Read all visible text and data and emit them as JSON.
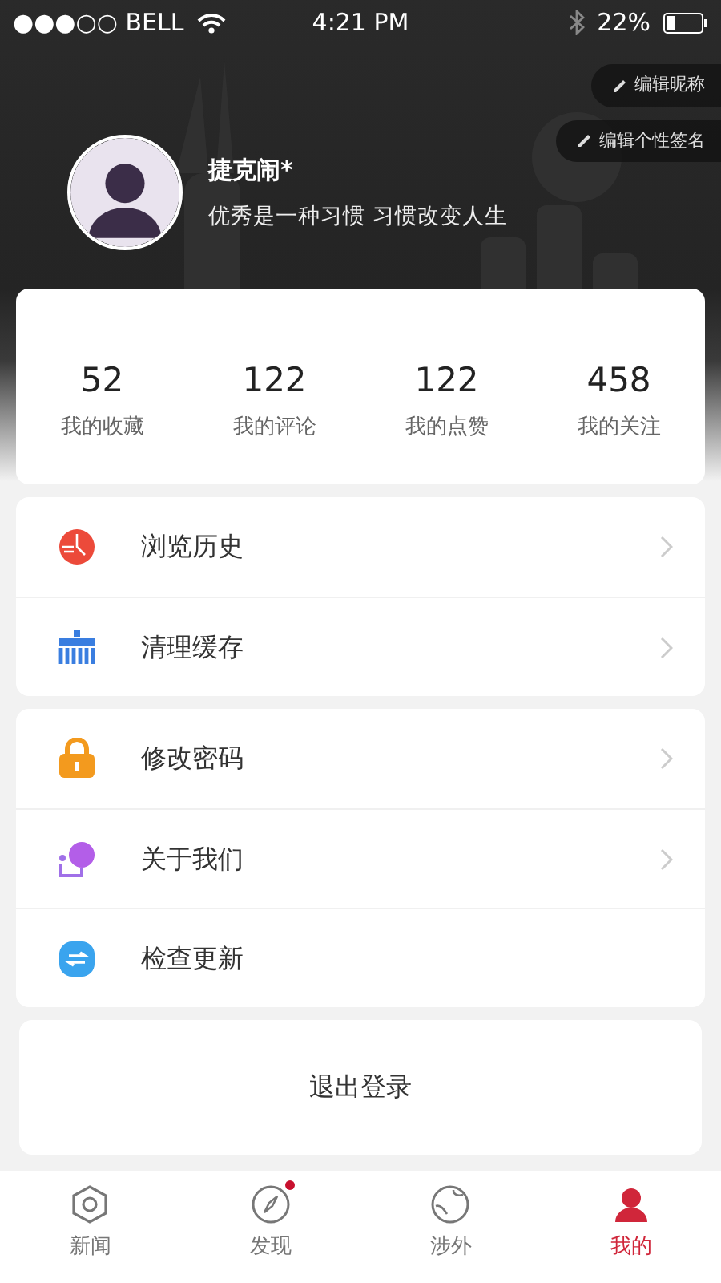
{
  "status_bar": {
    "carrier": "●●●○○ BELL",
    "time": "4:21 PM",
    "battery": "22%"
  },
  "profile": {
    "name": "捷克闹*",
    "motto": "优秀是一种习惯 习惯改变人生",
    "edit_buttons": [
      "编辑昵称",
      "编辑个性签名"
    ]
  },
  "stats": [
    {
      "value": "52",
      "label": "我的收藏"
    },
    {
      "value": "122",
      "label": "我的评论"
    },
    {
      "value": "122",
      "label": "我的点赞"
    },
    {
      "value": "458",
      "label": "我的关注"
    }
  ],
  "menu_groups": [
    [
      {
        "kind": "history",
        "label": "浏览历史",
        "chevron": true
      },
      {
        "kind": "clean",
        "label": "清理缓存",
        "chevron": true
      }
    ],
    [
      {
        "kind": "password",
        "label": "修改密码",
        "chevron": true
      },
      {
        "kind": "about",
        "label": "关于我们",
        "chevron": true
      },
      {
        "kind": "update",
        "label": "检查更新",
        "chevron": false
      }
    ]
  ],
  "logout": "退出登录",
  "tabs": [
    {
      "kind": "news",
      "label": "新闻",
      "selected": false,
      "dot": false
    },
    {
      "kind": "discover",
      "label": "发现",
      "selected": false,
      "dot": true
    },
    {
      "kind": "foreign",
      "label": "涉外",
      "selected": false,
      "dot": false
    },
    {
      "kind": "mine",
      "label": "我的",
      "selected": true,
      "dot": false
    }
  ]
}
